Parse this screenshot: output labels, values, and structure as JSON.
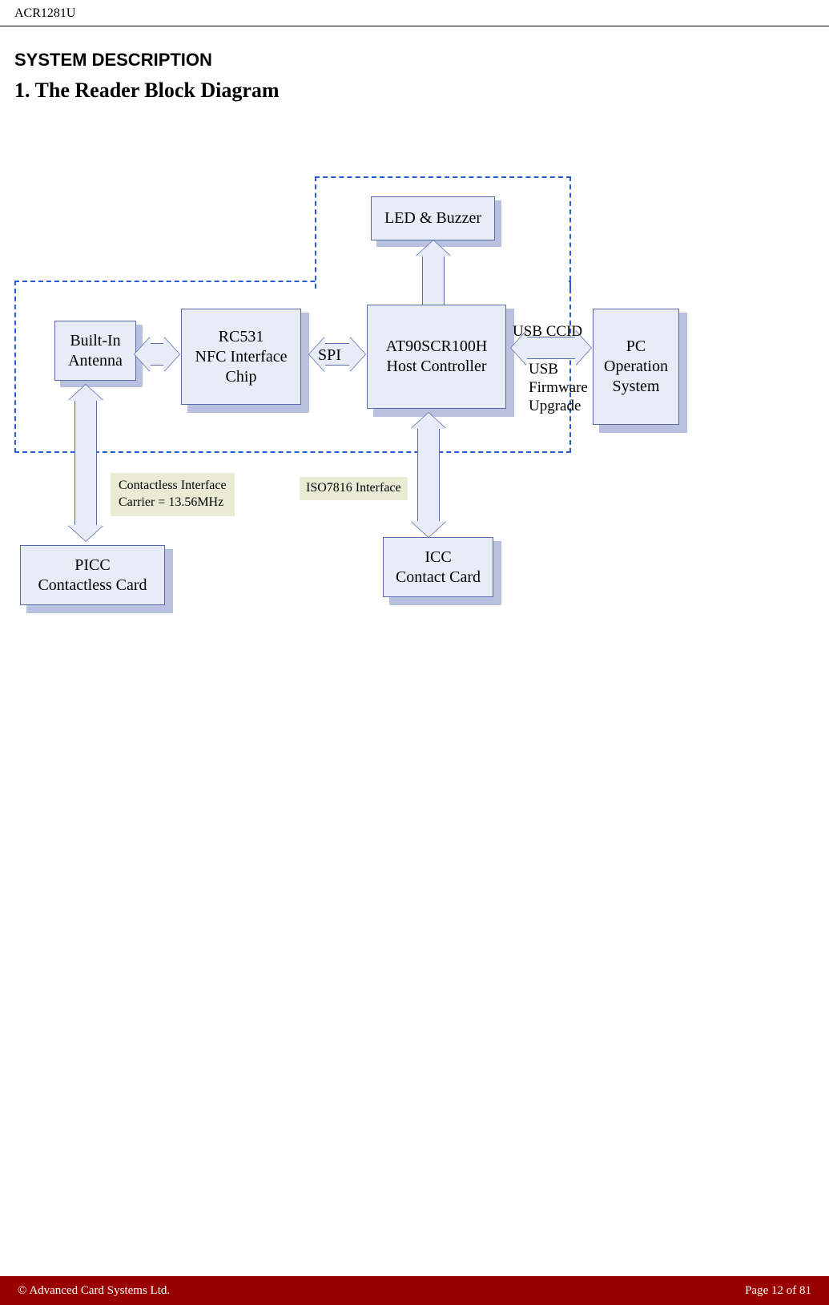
{
  "header": {
    "doc_id": "ACR1281U"
  },
  "titles": {
    "section": "SYSTEM DESCRIPTION",
    "subsection": "1. The Reader Block Diagram"
  },
  "blocks": {
    "led_buzzer": "LED & Buzzer",
    "antenna_l1": "Built-In",
    "antenna_l2": "Antenna",
    "nfc_l1": "RC531",
    "nfc_l2": "NFC Interface",
    "nfc_l3": "Chip",
    "host_l1": "AT90SCR100H",
    "host_l2": "Host Controller",
    "pc_l1": "PC",
    "pc_l2": "Operation",
    "pc_l3": "System",
    "picc_l1": "PICC",
    "picc_l2": "Contactless Card",
    "icc_l1": "ICC",
    "icc_l2": "Contact Card"
  },
  "labels": {
    "spi": "SPI",
    "usb_ccid": "USB CCID",
    "usb_fw_l1": "USB",
    "usb_fw_l2": "Firmware",
    "usb_fw_l3": "Upgrade",
    "iso7816": "ISO7816 Interface",
    "contactless_l1": "Contactless Interface",
    "contactless_l2": "Carrier = 13.56MHz"
  },
  "footer": {
    "copyright": "© Advanced Card Systems Ltd.",
    "page": "Page 12 of 81"
  }
}
